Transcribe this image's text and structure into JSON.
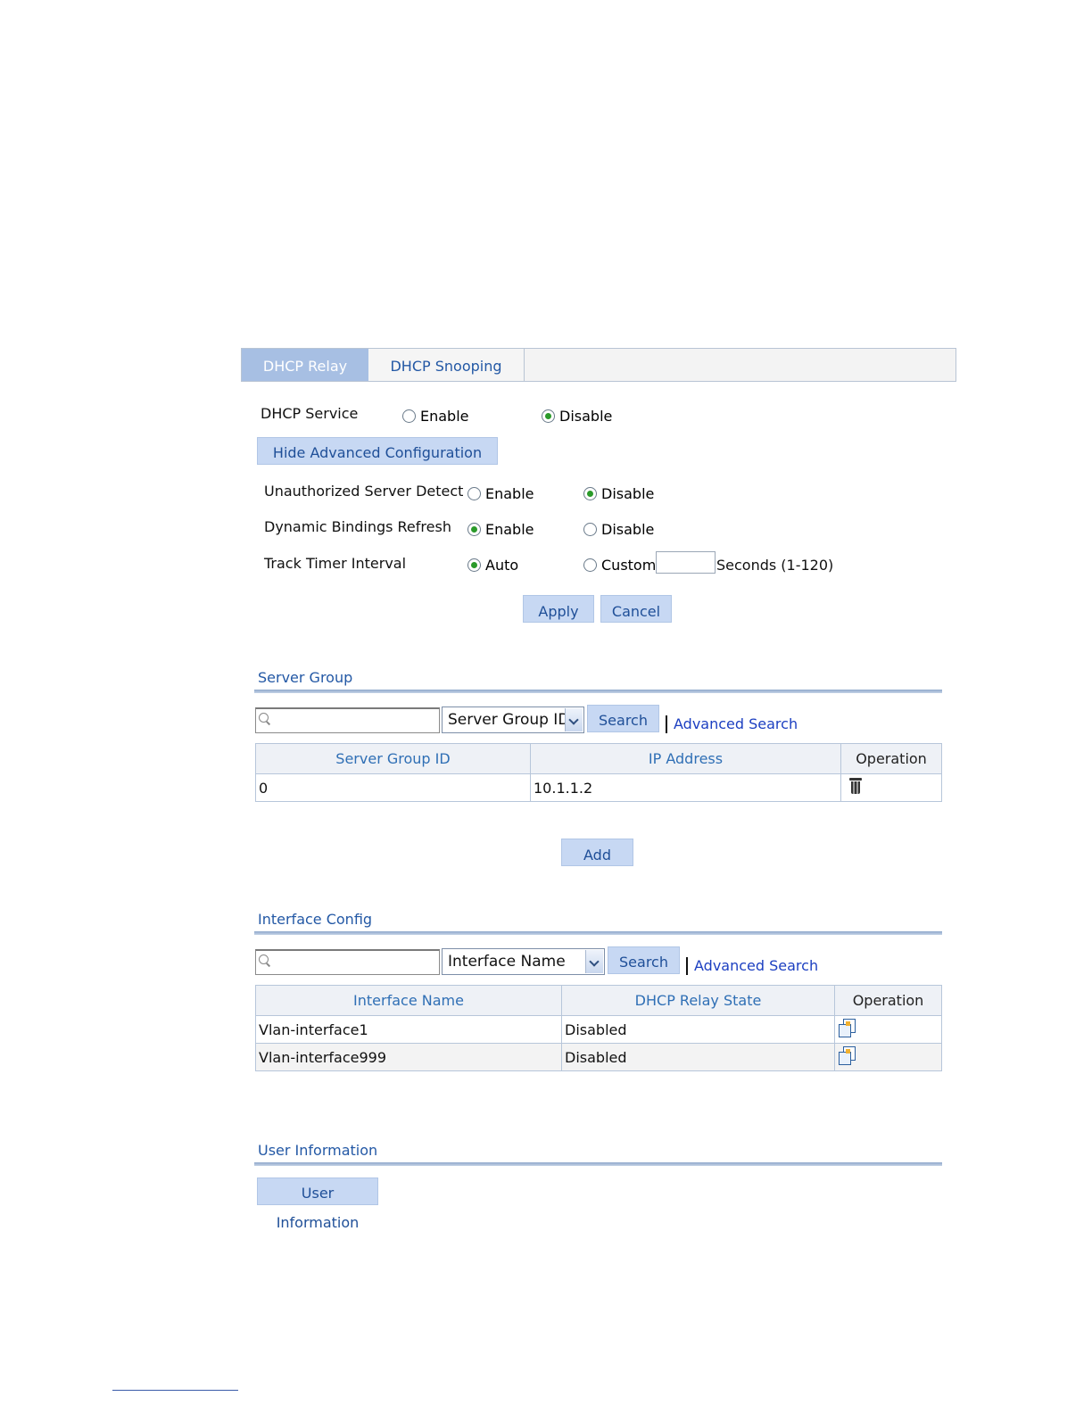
{
  "tabs": [
    {
      "label": "DHCP Relay",
      "active": true
    },
    {
      "label": "DHCP Snooping",
      "active": false
    }
  ],
  "dhcp_service": {
    "label": "DHCP Service",
    "enable_label": "Enable",
    "disable_label": "Disable",
    "selected": "Disable"
  },
  "hide_advanced_label": "Hide Advanced Configuration",
  "advanced": {
    "unauthorized": {
      "label": "Unauthorized Server Detect",
      "enable_label": "Enable",
      "disable_label": "Disable",
      "selected": "Disable"
    },
    "dynamic": {
      "label": "Dynamic Bindings Refresh",
      "enable_label": "Enable",
      "disable_label": "Disable",
      "selected": "Enable"
    },
    "track": {
      "label": "Track Timer Interval",
      "auto_label": "Auto",
      "custom_label": "Custom",
      "custom_value": "",
      "units_label": "Seconds (1-120)",
      "selected": "Auto"
    }
  },
  "apply_label": "Apply",
  "cancel_label": "Cancel",
  "server_group": {
    "title": "Server Group",
    "search_value": "",
    "select_value": "Server Group ID",
    "search_label": "Search",
    "advanced_search_label": "Advanced Search",
    "columns": [
      "Server Group ID",
      "IP Address",
      "Operation"
    ],
    "rows": [
      {
        "id": "0",
        "ip": "10.1.1.2",
        "op_icon": "trash-icon"
      }
    ],
    "add_label": "Add"
  },
  "interface_config": {
    "title": "Interface Config",
    "search_value": "",
    "select_value": "Interface Name",
    "search_label": "Search",
    "advanced_search_label": "Advanced Search",
    "columns": [
      "Interface Name",
      "DHCP Relay State",
      "Operation"
    ],
    "rows": [
      {
        "name": "Vlan-interface1",
        "state": "Disabled",
        "op_icon": "edit-icon"
      },
      {
        "name": "Vlan-interface999",
        "state": "Disabled",
        "op_icon": "edit-icon"
      }
    ]
  },
  "user_information": {
    "title": "User Information",
    "button_label": "User Information"
  },
  "colors": {
    "tab_active_bg": "#a7bfe3",
    "button_bg": "#c7d8f3",
    "section_title": "#2358a5",
    "link": "#1c3fc1",
    "header_text": "#2f6fb5"
  }
}
